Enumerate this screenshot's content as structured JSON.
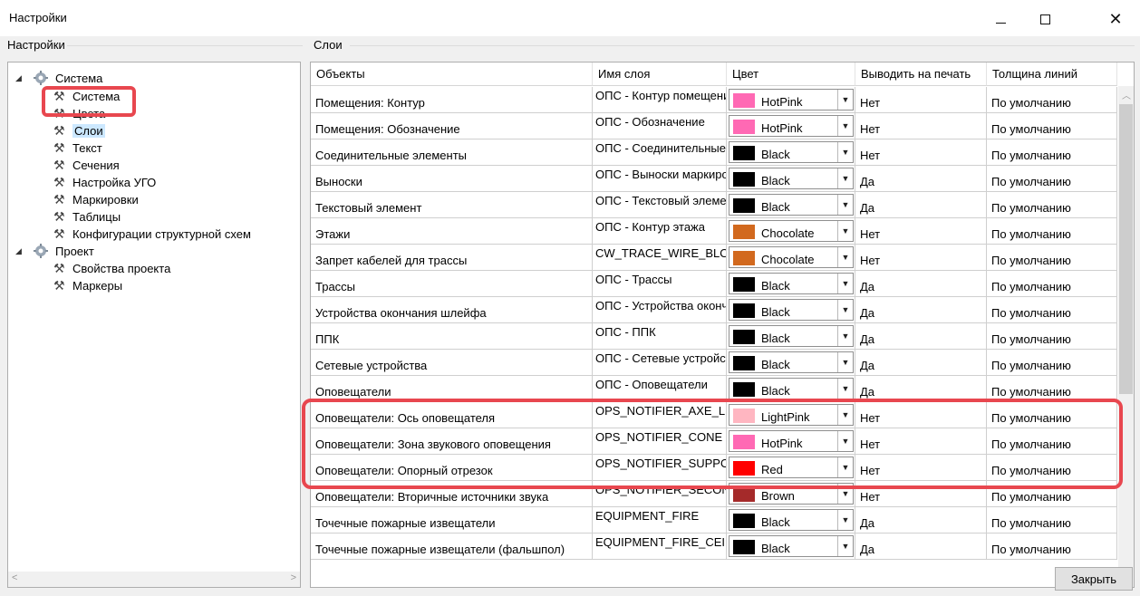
{
  "window": {
    "title": "Настройки"
  },
  "left_panel": {
    "group_label": "Настройки",
    "tree": [
      {
        "label": "Система",
        "level": 0,
        "expanded": true,
        "icon": "gear-icon"
      },
      {
        "label": "Система",
        "level": 1,
        "icon": "tools-icon"
      },
      {
        "label": "Цвета",
        "level": 1,
        "icon": "tools-icon"
      },
      {
        "label": "Слои",
        "level": 1,
        "icon": "tools-icon",
        "selected": true
      },
      {
        "label": "Текст",
        "level": 1,
        "icon": "tools-icon"
      },
      {
        "label": "Сечения",
        "level": 1,
        "icon": "tools-icon"
      },
      {
        "label": "Настройка УГО",
        "level": 1,
        "icon": "tools-icon"
      },
      {
        "label": "Маркировки",
        "level": 1,
        "icon": "tools-icon"
      },
      {
        "label": "Таблицы",
        "level": 1,
        "icon": "tools-icon"
      },
      {
        "label": "Конфигурации структурной схем",
        "level": 1,
        "icon": "tools-icon"
      },
      {
        "label": "Проект",
        "level": 0,
        "expanded": true,
        "icon": "gear-icon"
      },
      {
        "label": "Свойства проекта",
        "level": 1,
        "icon": "tools-icon"
      },
      {
        "label": "Маркеры",
        "level": 1,
        "icon": "tools-icon"
      }
    ]
  },
  "right_panel": {
    "group_label": "Слои",
    "columns": [
      "Объекты",
      "Имя слоя",
      "Цвет",
      "Выводить на печать",
      "Толщина линий"
    ],
    "rows": [
      {
        "object": "Помещения: Контур",
        "layer": "ОПС - Контур помещения",
        "color_name": "HotPink",
        "color_hex": "#ff69b4",
        "print": "Нет",
        "width": "По умолчанию"
      },
      {
        "object": "Помещения: Обозначение",
        "layer": "ОПС - Обозначение",
        "color_name": "HotPink",
        "color_hex": "#ff69b4",
        "print": "Нет",
        "width": "По умолчанию"
      },
      {
        "object": "Соединительные элементы",
        "layer": "ОПС - Соединительные",
        "color_name": "Black",
        "color_hex": "#000000",
        "print": "Нет",
        "width": "По умолчанию"
      },
      {
        "object": "Выноски",
        "layer": "ОПС - Выноски маркировки",
        "color_name": "Black",
        "color_hex": "#000000",
        "print": "Да",
        "width": "По умолчанию"
      },
      {
        "object": "Текстовый элемент",
        "layer": "ОПС - Текстовый элемент",
        "color_name": "Black",
        "color_hex": "#000000",
        "print": "Да",
        "width": "По умолчанию"
      },
      {
        "object": "Этажи",
        "layer": "ОПС - Контур этажа",
        "color_name": "Chocolate",
        "color_hex": "#d2691e",
        "print": "Нет",
        "width": "По умолчанию"
      },
      {
        "object": "Запрет кабелей для трассы",
        "layer": "CW_TRACE_WIRE_BLOCK",
        "color_name": "Chocolate",
        "color_hex": "#d2691e",
        "print": "Нет",
        "width": "По умолчанию"
      },
      {
        "object": "Трассы",
        "layer": "ОПС - Трассы",
        "color_name": "Black",
        "color_hex": "#000000",
        "print": "Да",
        "width": "По умолчанию"
      },
      {
        "object": "Устройства окончания шлейфа",
        "layer": "ОПС - Устройства окончания",
        "color_name": "Black",
        "color_hex": "#000000",
        "print": "Да",
        "width": "По умолчанию"
      },
      {
        "object": "ППК",
        "layer": "ОПС - ППК",
        "color_name": "Black",
        "color_hex": "#000000",
        "print": "Да",
        "width": "По умолчанию"
      },
      {
        "object": "Сетевые устройства",
        "layer": "ОПС - Сетевые устройства",
        "color_name": "Black",
        "color_hex": "#000000",
        "print": "Да",
        "width": "По умолчанию"
      },
      {
        "object": "Оповещатели",
        "layer": "ОПС - Оповещатели",
        "color_name": "Black",
        "color_hex": "#000000",
        "print": "Да",
        "width": "По умолчанию"
      },
      {
        "object": "Оповещатели: Ось оповещателя",
        "layer": "OPS_NOTIFIER_AXE_LINE",
        "color_name": "LightPink",
        "color_hex": "#ffb6c1",
        "print": "Нет",
        "width": "По умолчанию"
      },
      {
        "object": "Оповещатели: Зона звукового оповещения",
        "layer": "OPS_NOTIFIER_CONE",
        "color_name": "HotPink",
        "color_hex": "#ff69b4",
        "print": "Нет",
        "width": "По умолчанию"
      },
      {
        "object": "Оповещатели: Опорный отрезок",
        "layer": "OPS_NOTIFIER_SUPPORT",
        "color_name": "Red",
        "color_hex": "#ff0000",
        "print": "Нет",
        "width": "По умолчанию"
      },
      {
        "object": "Оповещатели: Вторичные источники звука",
        "layer": "OPS_NOTIFIER_SECONDARY",
        "color_name": "Brown",
        "color_hex": "#a52a2a",
        "print": "Нет",
        "width": "По умолчанию"
      },
      {
        "object": "Точечные пожарные извещатели",
        "layer": "EQUIPMENT_FIRE",
        "color_name": "Black",
        "color_hex": "#000000",
        "print": "Да",
        "width": "По умолчанию"
      },
      {
        "object": "Точечные пожарные извещатели (фальшпол)",
        "layer": "EQUIPMENT_FIRE_CEIL",
        "color_name": "Black",
        "color_hex": "#000000",
        "print": "Да",
        "width": "По умолчанию"
      }
    ]
  },
  "footer": {
    "close_label": "Закрыть"
  },
  "colors": {
    "highlight": "#e8474f",
    "selection": "#cce8ff"
  }
}
